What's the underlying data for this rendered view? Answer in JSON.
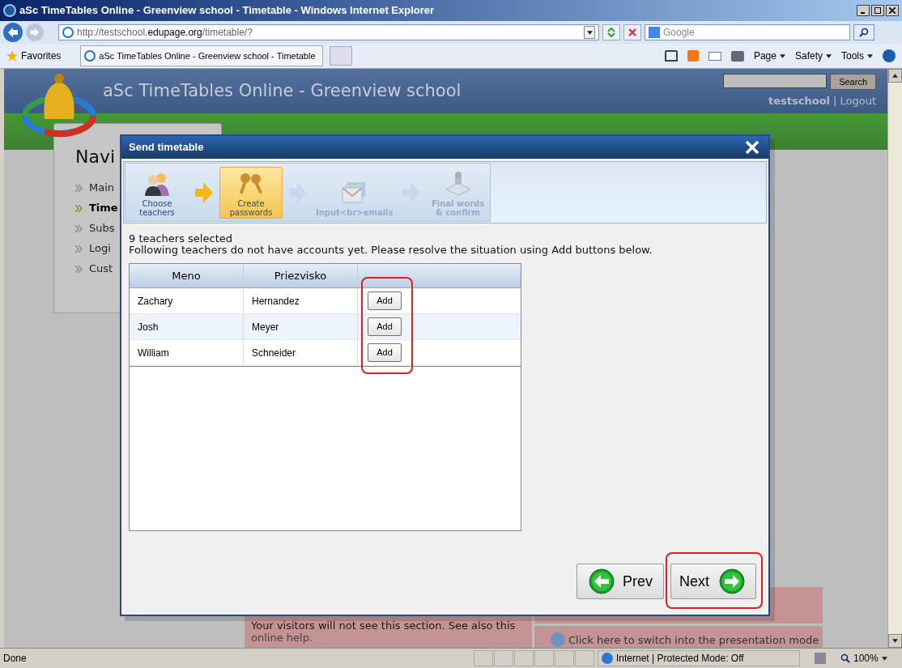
{
  "browser": {
    "title": "aSc TimeTables Online - Greenview school - Timetable - Windows Internet Explorer",
    "address_host": "http://testschool.",
    "address_domain": "edupage.org",
    "address_path": "/timetable/?",
    "search_placeholder": "Google",
    "favorites": "Favorites",
    "tab": "aSc TimeTables Online - Greenview school - Timetable",
    "menus": [
      "Page",
      "Safety",
      "Tools"
    ]
  },
  "page": {
    "title": "aSc TimeTables Online - Greenview school",
    "search_button": "Search",
    "user": "testschool",
    "separator": "|",
    "logout": "Logout",
    "nav_heading": "Navi",
    "nav_items": [
      {
        "label": "Main",
        "selected": false
      },
      {
        "label": "Time",
        "selected": true
      },
      {
        "label": "Subs",
        "selected": false
      },
      {
        "label": "Logi",
        "selected": false
      },
      {
        "label": "Cust",
        "selected": false
      }
    ],
    "notice": "Your visitors will not see this section. See also this",
    "notice_link": "online help.",
    "presentation_link": "Click here to switch into the presentation mode"
  },
  "dialog": {
    "title": "Send timetable",
    "steps": [
      {
        "label": "Choose teachers",
        "selected": false,
        "disabled": false
      },
      {
        "label": "Create passwords",
        "selected": true,
        "disabled": false
      },
      {
        "label": "Input<br>emails",
        "selected": false,
        "disabled": true
      },
      {
        "label": "Final words & confirm",
        "selected": false,
        "disabled": true
      }
    ],
    "summary": "9 teachers selected",
    "instructions": "Following teachers do not have accounts yet. Please resolve the situation using Add buttons below.",
    "columns": [
      "Meno",
      "Priezvisko"
    ],
    "rows": [
      {
        "first": "Zachary",
        "last": "Hernandez",
        "action": "Add"
      },
      {
        "first": "Josh",
        "last": "Meyer",
        "action": "Add"
      },
      {
        "first": "William",
        "last": "Schneider",
        "action": "Add"
      }
    ],
    "prev": "Prev",
    "next": "Next"
  },
  "status": {
    "text": "Done",
    "zone": "Internet | Protected Mode: Off",
    "zoom": "100%"
  }
}
